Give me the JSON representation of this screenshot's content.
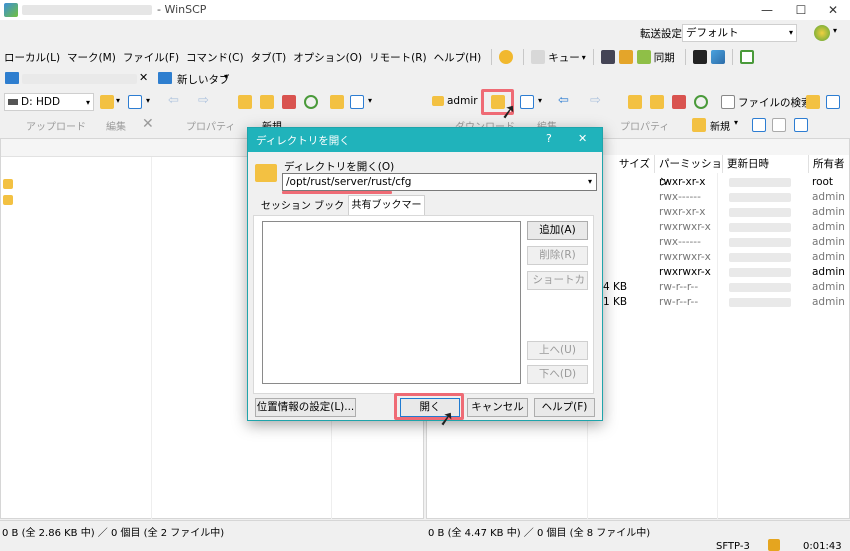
{
  "window": {
    "title": "- WinSCP",
    "min": "—",
    "max": "☐",
    "close": "✕"
  },
  "transfer": {
    "label": "転送設定",
    "value": "デフォルト"
  },
  "menu": [
    "ローカル(L)",
    "マーク(M)",
    "ファイル(F)",
    "コマンド(C)",
    "タブ(T)",
    "オプション(O)",
    "リモート(R)",
    "ヘルプ(H)"
  ],
  "toolbar": {
    "queue": "キュー",
    "sync": "同期"
  },
  "tabs": {
    "new_tab": "新しいタブ"
  },
  "local": {
    "drive": "D: HDD",
    "upload": "アップロード",
    "edit": "編集",
    "properties": "プロパティ",
    "new": "新規"
  },
  "remote": {
    "path": "admir",
    "download": "ダウンロード",
    "edit": "編集",
    "properties": "プロパティ",
    "new": "新規",
    "find": "ファイルの検索"
  },
  "remote_columns": [
    "サイズ",
    "パーミッション",
    "更新日時",
    "所有者"
  ],
  "remote_rows": [
    {
      "size": "",
      "perm": "rwxr-xr-x",
      "owner": "root",
      "active": true
    },
    {
      "size": "",
      "perm": "rwx------",
      "owner": "admin",
      "active": false
    },
    {
      "size": "",
      "perm": "rwxr-xr-x",
      "owner": "admin",
      "active": false
    },
    {
      "size": "",
      "perm": "rwxrwxr-x",
      "owner": "admin",
      "active": false
    },
    {
      "size": "",
      "perm": "rwx------",
      "owner": "admin",
      "active": false
    },
    {
      "size": "",
      "perm": "rwxrwxr-x",
      "owner": "admin",
      "active": false
    },
    {
      "size": "",
      "perm": "rwxrwxr-x",
      "owner": "admin",
      "active": true
    },
    {
      "size": "4 KB",
      "perm": "rw-r--r--",
      "owner": "admin",
      "active": false
    },
    {
      "size": "1 KB",
      "perm": "rw-r--r--",
      "owner": "admin",
      "active": false
    }
  ],
  "dialog": {
    "title": "ディレクトリを開く",
    "help": "?",
    "close": "✕",
    "label": "ディレクトリを開く(O)",
    "path": "/opt/rust/server/rust/cfg",
    "tab_session": "セッション ブックマーク",
    "tab_shared": "共有ブックマーク",
    "add": "追加(A)",
    "delete": "削除(R)",
    "shortcut": "ショートカット(S)...",
    "up": "上へ(U)",
    "down": "下へ(D)",
    "location": "位置情報の設定(L)...",
    "open": "開く",
    "cancel": "キャンセル",
    "helpbtn": "ヘルプ(F)"
  },
  "status": {
    "left": "0 B (全 2.86 KB 中) ／ 0 個目 (全 2 ファイル中)",
    "right": "0 B (全 4.47 KB 中) ／ 0 個目 (全 8 ファイル中)",
    "protocol": "SFTP-3",
    "time": "0:01:43"
  },
  "colors": {
    "accent": "#20b3bb",
    "highlight": "#ef6b75",
    "folder": "#f3c142"
  }
}
